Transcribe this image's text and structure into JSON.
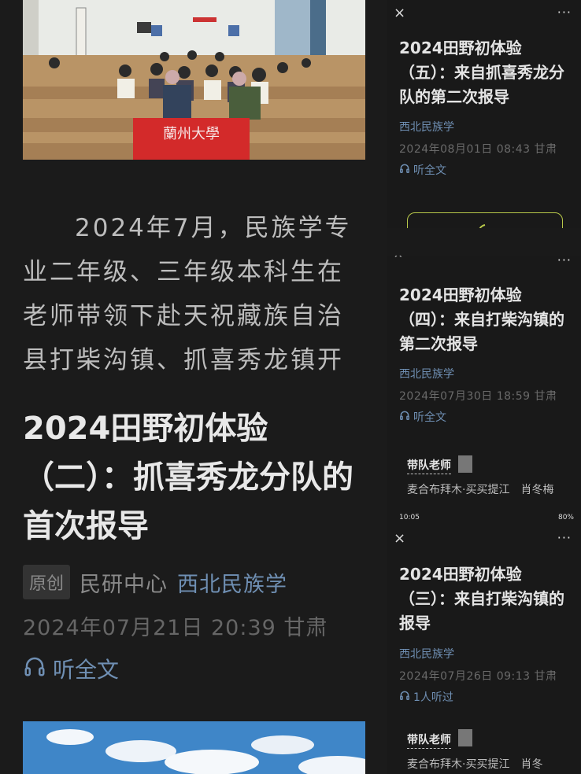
{
  "main": {
    "paragraph": "2024年7月，民族学专业二年级、三年级本科生在老师带领下赴天祝藏族自治县打柴沟镇、抓喜秀龙镇开",
    "title": "2024田野初体验（二）：抓喜秀龙分队的首次报导",
    "badge": "原创",
    "author": "民研中心",
    "account": "西北民族学",
    "date": "2024年07月21日 20:39 甘肃",
    "listen": "听全文",
    "banner_text": "蘭州大學"
  },
  "panels": [
    {
      "close": "×",
      "more": "···",
      "title": "2024田野初体验（五）：来自抓喜秀龙分队的第二次报导",
      "account": "西北民族学",
      "date": "2024年08月01日 08:43 甘肃",
      "listen": "听全文"
    },
    {
      "more": "···",
      "title": "2024田野初体验（四）：来自打柴沟镇的第二次报导",
      "account": "西北民族学",
      "date": "2024年07月30日 18:59 甘肃",
      "listen": "听全文",
      "teacher_label": "带队老师",
      "teacher_names": "麦合布拜木·买买提江　肖冬梅",
      "status_time": "10:05",
      "status_right": "80%"
    },
    {
      "close": "×",
      "more": "···",
      "title": "2024田野初体验（三）：来自打柴沟镇的报导",
      "account": "西北民族学",
      "date": "2024年07月26日 09:13 甘肃",
      "listen": "1人听过",
      "teacher_label": "带队老师",
      "teacher_names": "麦合布拜木·买买提江　肖冬"
    }
  ],
  "colors": {
    "link": "#6f8fb3",
    "background": "#1a1a1a"
  }
}
